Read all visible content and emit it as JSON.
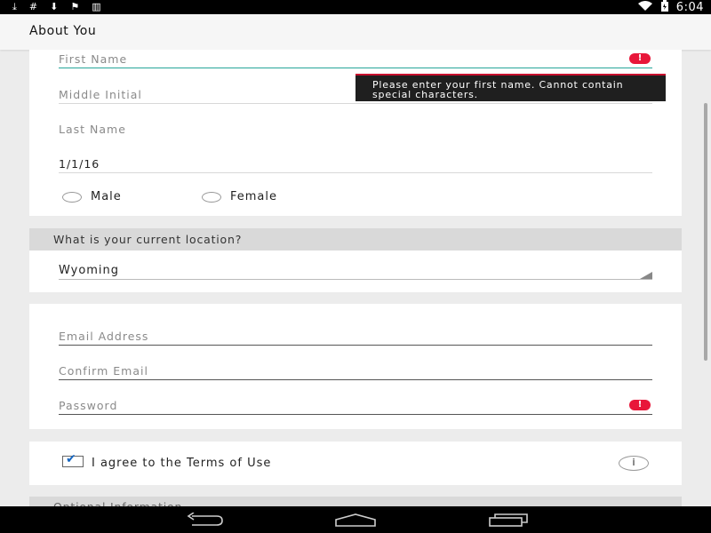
{
  "status_bar": {
    "left_icons": [
      "download-icon",
      "hash-icon",
      "download-box-icon",
      "flag-icon",
      "barcode-icon"
    ],
    "right_icons": [
      "wifi-icon",
      "battery-charging-icon"
    ],
    "time": "6:04"
  },
  "app_bar": {
    "title": "About You"
  },
  "personal": {
    "first_name": {
      "placeholder": "First Name",
      "error": "!"
    },
    "first_name_error_tooltip": "Please enter your first name. Cannot contain special characters.",
    "middle_initial": {
      "placeholder": "Middle Initial"
    },
    "last_name": {
      "placeholder": "Last Name"
    },
    "birth_date": {
      "value": "1/1/16"
    },
    "gender": {
      "male": "Male",
      "female": "Female"
    }
  },
  "location": {
    "question": "What is your current location?",
    "selected": "Wyoming"
  },
  "account": {
    "email": {
      "placeholder": "Email Address"
    },
    "confirm_email": {
      "placeholder": "Confirm Email"
    },
    "password": {
      "placeholder": "Password",
      "error": "!"
    }
  },
  "terms": {
    "label": "I agree to the Terms of Use",
    "checked": true,
    "info": "i"
  },
  "optional": {
    "header": "Optional Information"
  },
  "nav_bar": {
    "buttons": [
      "back-icon",
      "home-icon",
      "recents-icon"
    ]
  },
  "colors": {
    "error": "#e8173a",
    "accent": "#26a69a",
    "checkbox": "#1565c0"
  }
}
